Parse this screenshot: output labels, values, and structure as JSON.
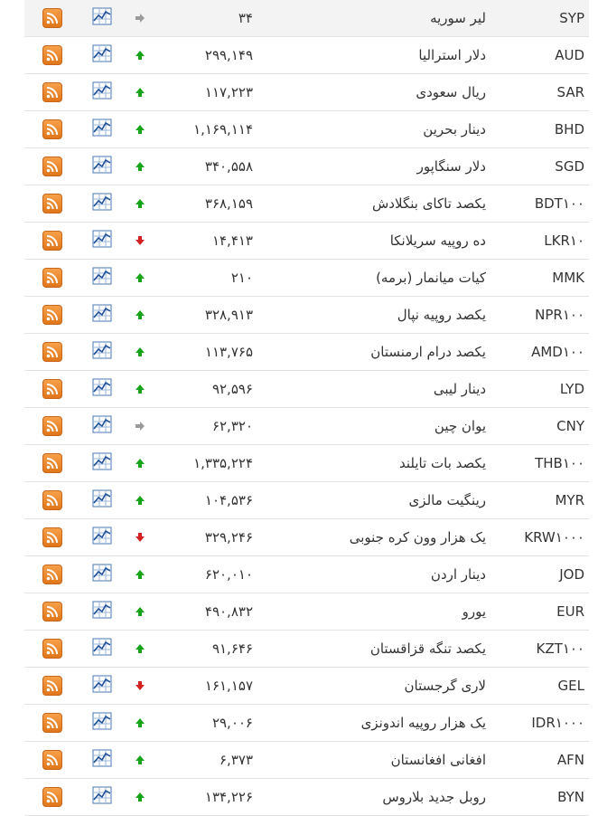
{
  "rows": [
    {
      "code": "SYP",
      "name": "لیر سوریه",
      "price": "۳۴",
      "trend": "flat"
    },
    {
      "code": "AUD",
      "name": "دلار استرالیا",
      "price": "۲۹۹,۱۴۹",
      "trend": "up"
    },
    {
      "code": "SAR",
      "name": "ریال سعودی",
      "price": "۱۱۷,۲۲۳",
      "trend": "up"
    },
    {
      "code": "BHD",
      "name": "دینار بحرین",
      "price": "۱,۱۶۹,۱۱۴",
      "trend": "up"
    },
    {
      "code": "SGD",
      "name": "دلار سنگاپور",
      "price": "۳۴۰,۵۵۸",
      "trend": "up"
    },
    {
      "code": "BDT۱۰۰",
      "name": "یکصد تاکای بنگلادش",
      "price": "۳۶۸,۱۵۹",
      "trend": "up"
    },
    {
      "code": "LKR۱۰",
      "name": "ده روپیه سریلانکا",
      "price": "۱۴,۴۱۳",
      "trend": "down"
    },
    {
      "code": "MMK",
      "name": "کیات میانمار (برمه)",
      "price": "۲۱۰",
      "trend": "up"
    },
    {
      "code": "NPR۱۰۰",
      "name": "یکصد روپیه نپال",
      "price": "۳۲۸,۹۱۳",
      "trend": "up"
    },
    {
      "code": "AMD۱۰۰",
      "name": "یکصد درام ارمنستان",
      "price": "۱۱۳,۷۶۵",
      "trend": "up"
    },
    {
      "code": "LYD",
      "name": "دینار لیبی",
      "price": "۹۲,۵۹۶",
      "trend": "up"
    },
    {
      "code": "CNY",
      "name": "یوان چین",
      "price": "۶۲,۳۲۰",
      "trend": "flat"
    },
    {
      "code": "THB۱۰۰",
      "name": "یکصد بات تایلند",
      "price": "۱,۳۳۵,۲۲۴",
      "trend": "up"
    },
    {
      "code": "MYR",
      "name": "رینگیت مالزی",
      "price": "۱۰۴,۵۳۶",
      "trend": "up"
    },
    {
      "code": "KRW۱۰۰۰",
      "name": "یک هزار وون کره جنوبی",
      "price": "۳۲۹,۲۴۶",
      "trend": "down"
    },
    {
      "code": "JOD",
      "name": "دینار اردن",
      "price": "۶۲۰,۰۱۰",
      "trend": "up"
    },
    {
      "code": "EUR",
      "name": "یورو",
      "price": "۴۹۰,۸۳۲",
      "trend": "up"
    },
    {
      "code": "KZT۱۰۰",
      "name": "یکصد تنگه قزاقستان",
      "price": "۹۱,۶۴۶",
      "trend": "up"
    },
    {
      "code": "GEL",
      "name": "لاری گرجستان",
      "price": "۱۶۱,۱۵۷",
      "trend": "down"
    },
    {
      "code": "IDR۱۰۰۰",
      "name": "یک هزار روپیه اندونزی",
      "price": "۲۹,۰۰۶",
      "trend": "up"
    },
    {
      "code": "AFN",
      "name": "افغانی افغانستان",
      "price": "۶,۳۷۳",
      "trend": "up"
    },
    {
      "code": "BYN",
      "name": "روبل جدید بلاروس",
      "price": "۱۳۴,۲۲۶",
      "trend": "up"
    }
  ],
  "colors": {
    "up": "#19a319",
    "down": "#d42121",
    "flat": "#9a9a9a"
  },
  "icons": {
    "rss": "rss-feed-icon",
    "chart": "chart-icon"
  }
}
